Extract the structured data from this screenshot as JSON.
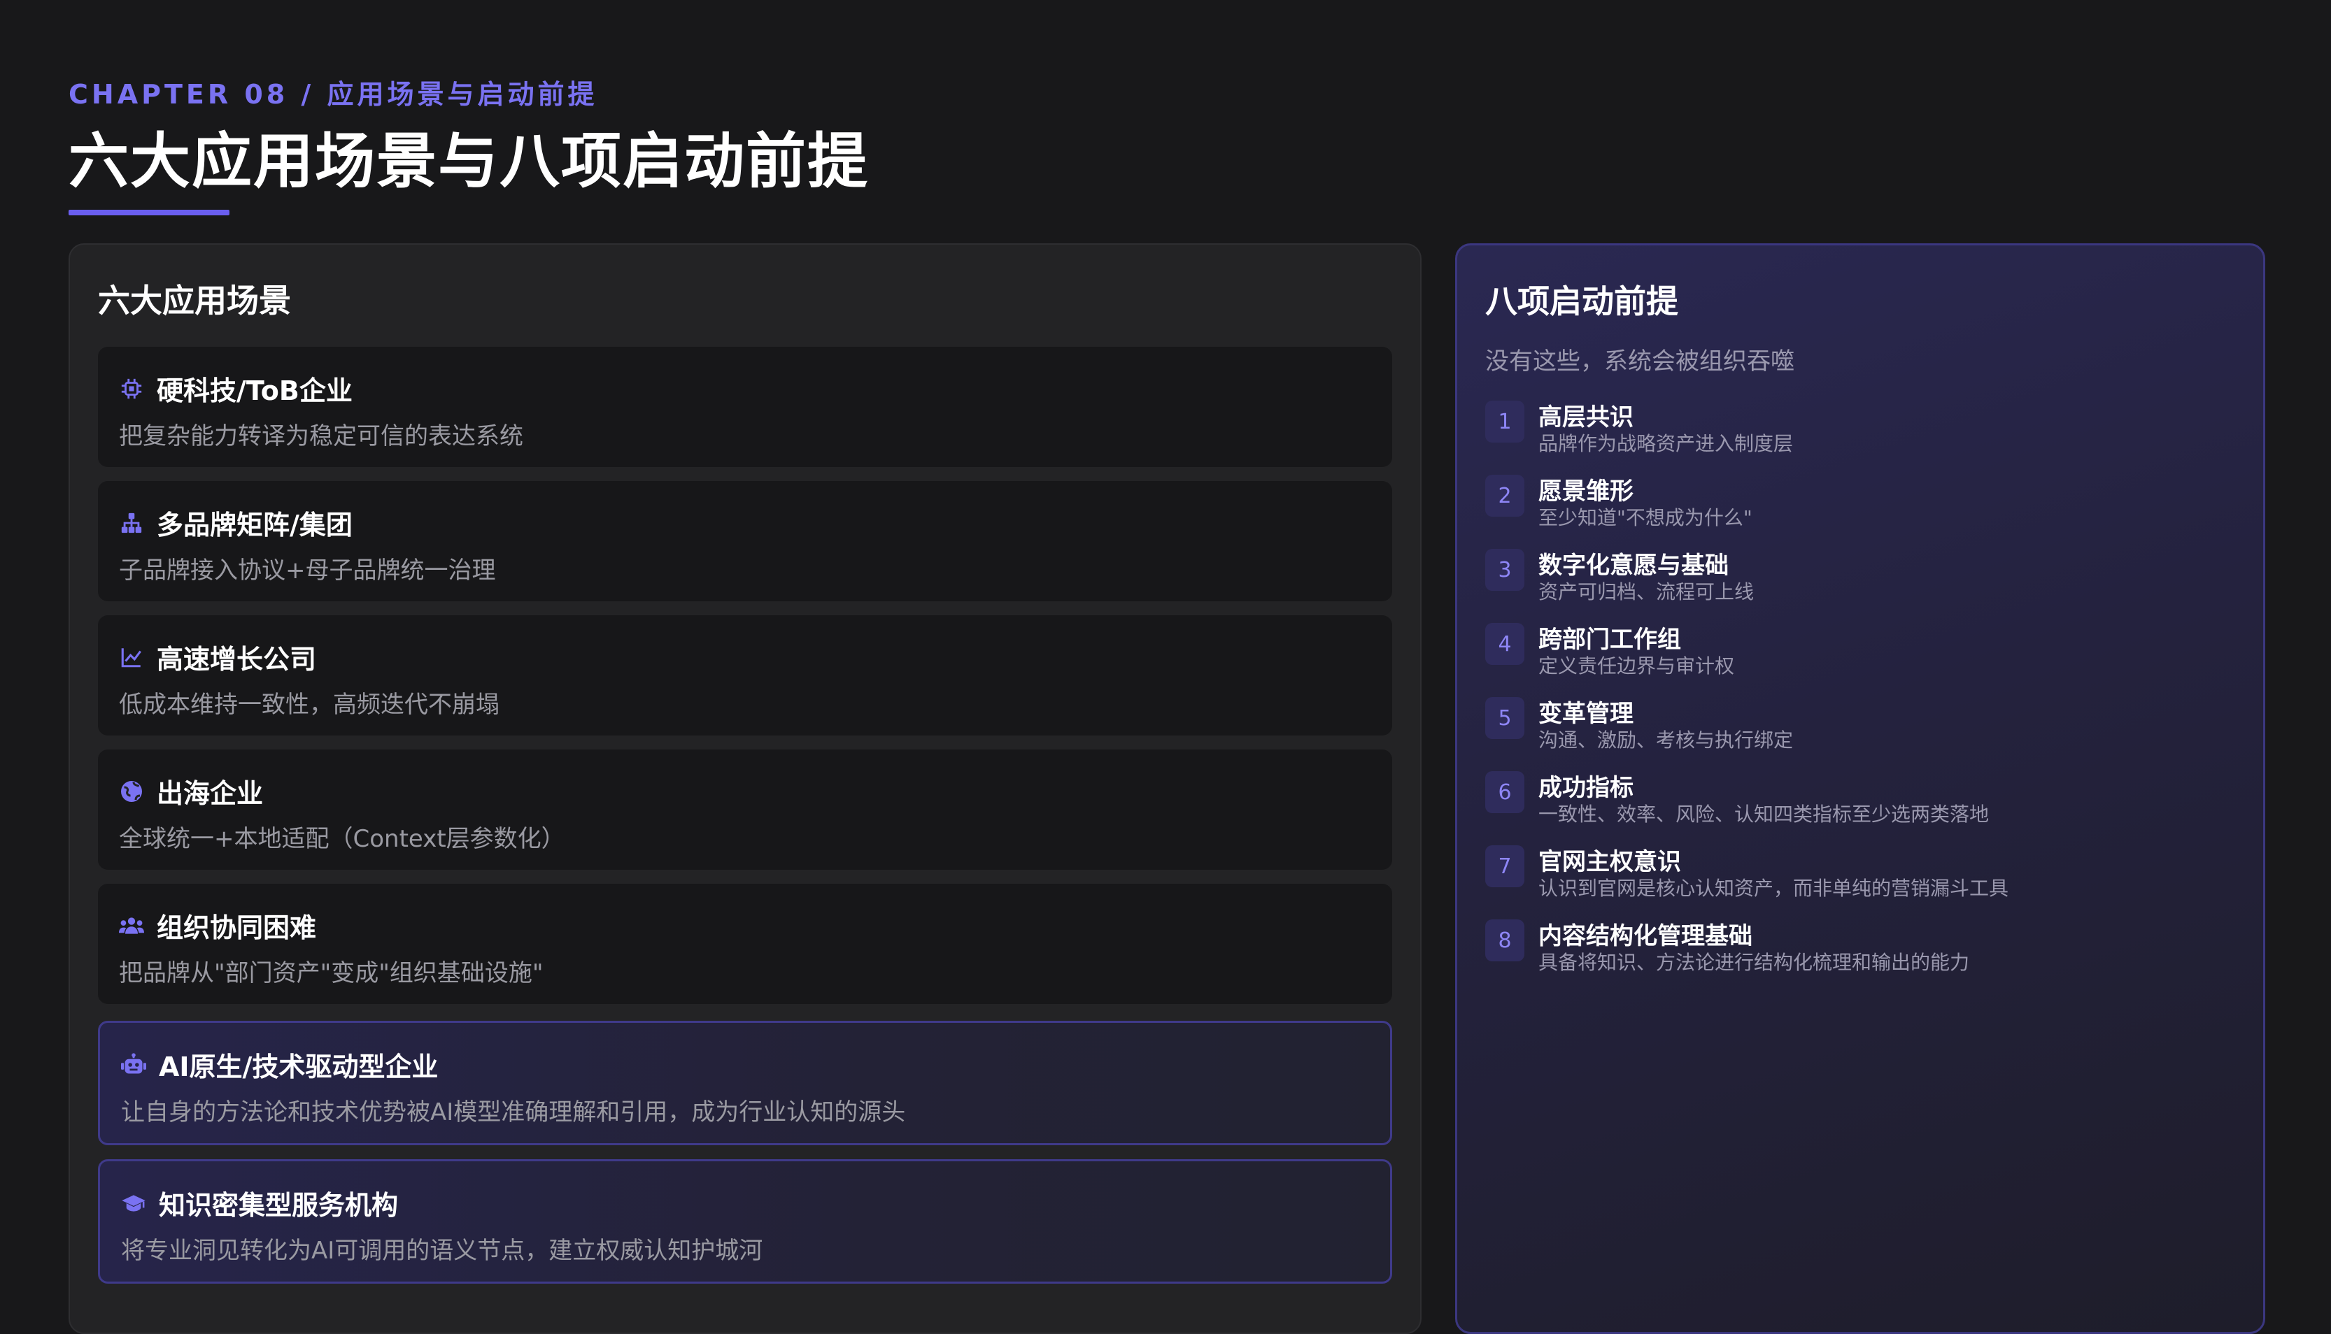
{
  "header": {
    "chapter": "CHAPTER 08 / 应用场景与启动前提",
    "title": "六大应用场景与八项启动前提"
  },
  "scenes": {
    "heading": "六大应用场景",
    "items": [
      {
        "icon": "chip-icon",
        "title": "硬科技/ToB企业",
        "desc": "把复杂能力转译为稳定可信的表达系统"
      },
      {
        "icon": "sitemap-icon",
        "title": "多品牌矩阵/集团",
        "desc": "子品牌接入协议+母子品牌统一治理"
      },
      {
        "icon": "chart-line-icon",
        "title": "高速增长公司",
        "desc": "低成本维持一致性，高频迭代不崩塌"
      },
      {
        "icon": "globe-icon",
        "title": "出海企业",
        "desc": "全球统一+本地适配（Context层参数化）"
      },
      {
        "icon": "users-icon",
        "title": "组织协同困难",
        "desc": "把品牌从\"部门资产\"变成\"组织基础设施\""
      },
      {
        "icon": "robot-icon",
        "title": "AI原生/技术驱动型企业",
        "desc": "让自身的方法论和技术优势被AI模型准确理解和引用，成为行业认知的源头"
      },
      {
        "icon": "graduation-cap-icon",
        "title": "知识密集型服务机构",
        "desc": "将专业洞见转化为AI可调用的语义节点，建立权威认知护城河"
      }
    ]
  },
  "premises": {
    "heading": "八项启动前提",
    "subtitle": "没有这些，系统会被组织吞噬",
    "items": [
      {
        "num": "1",
        "title": "高层共识",
        "desc": "品牌作为战略资产进入制度层"
      },
      {
        "num": "2",
        "title": "愿景雏形",
        "desc": "至少知道\"不想成为什么\""
      },
      {
        "num": "3",
        "title": "数字化意愿与基础",
        "desc": "资产可归档、流程可上线"
      },
      {
        "num": "4",
        "title": "跨部门工作组",
        "desc": "定义责任边界与审计权"
      },
      {
        "num": "5",
        "title": "变革管理",
        "desc": "沟通、激励、考核与执行绑定"
      },
      {
        "num": "6",
        "title": "成功指标",
        "desc": "一致性、效率、风险、认知四类指标至少选两类落地"
      },
      {
        "num": "7",
        "title": "官网主权意识",
        "desc": "认识到官网是核心认知资产，而非单纯的营销漏斗工具"
      },
      {
        "num": "8",
        "title": "内容结构化管理基础",
        "desc": "具备将知识、方法论进行结构化梳理和输出的能力"
      }
    ]
  },
  "colors": {
    "accent": "#6a5ef0",
    "background": "#18181a",
    "card": "#171719"
  }
}
